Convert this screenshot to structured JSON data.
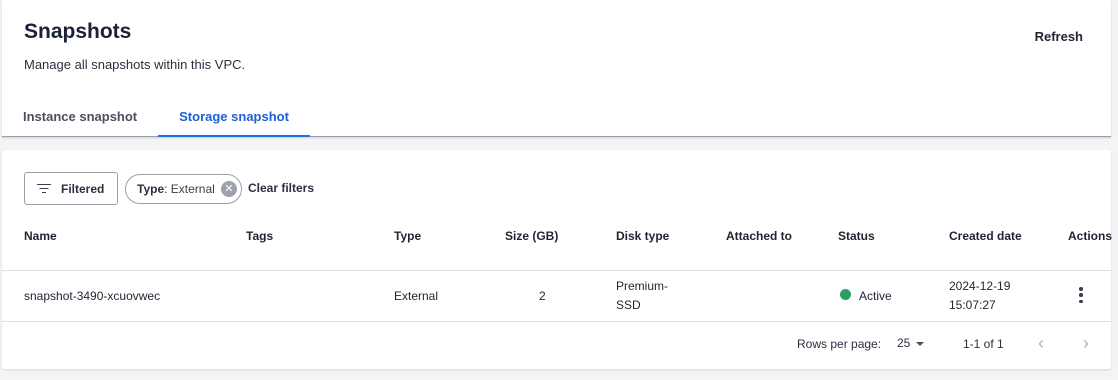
{
  "header": {
    "title": "Snapshots",
    "subtitle": "Manage all snapshots within this VPC.",
    "refresh_label": "Refresh"
  },
  "tabs": [
    {
      "label": "Instance snapshot",
      "active": false
    },
    {
      "label": "Storage snapshot",
      "active": true
    }
  ],
  "toolbar": {
    "filter_label": "Filtered",
    "filter_icon": "filter-list-icon",
    "chip": {
      "key": "Type",
      "sep": ":",
      "value": " External",
      "close_icon": "close-circle-icon"
    },
    "clear_filters_label": "Clear filters"
  },
  "table": {
    "columns": [
      "Name",
      "Tags",
      "Type",
      "Size (GB)",
      "Disk type",
      "Attached to",
      "Status",
      "Created date",
      "Actions"
    ],
    "rows": [
      {
        "name": "snapshot-3490-xcuovwec",
        "tags": "",
        "type": "External",
        "size": "2",
        "disk_type_line1": "Premium-",
        "disk_type_line2": "SSD",
        "attached_to": "",
        "status": "Active",
        "created_date": "2024-12-19",
        "created_time": "15:07:27",
        "actions_icon": "more-vertical-icon"
      }
    ]
  },
  "pagination": {
    "rows_per_page_label": "Rows per page:",
    "rows_per_page_value": "25",
    "range": "1-1 of 1",
    "prev_icon": "chevron-left-icon",
    "next_icon": "chevron-right-icon"
  },
  "colors": {
    "accent": "#1f6fe0",
    "status_active": "#2e9d5f"
  }
}
